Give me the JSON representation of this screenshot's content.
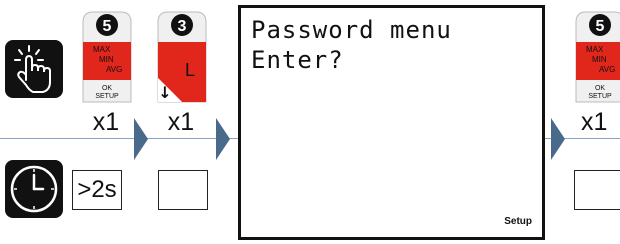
{
  "colors": {
    "accent_red": "#e1261c",
    "tile_dark": "#111111",
    "separator": "#8aa3bf",
    "chevron": "#4a6a8c"
  },
  "icons": {
    "touch": "tap-finger-icon",
    "timer": "clock-icon",
    "step_arrow": "chevron-right-icon"
  },
  "steps": [
    {
      "key": {
        "number": "5",
        "lines": [
          "MAX",
          "MIN",
          "AVG"
        ],
        "sub": [
          "OK",
          "SETUP"
        ]
      },
      "presses": "x1",
      "hold": ">2s"
    },
    {
      "key": {
        "number": "3",
        "letter": "L",
        "down_arrow": "↓"
      },
      "presses": "x1",
      "hold": ""
    },
    {
      "key": {
        "number": "5",
        "lines": [
          "MAX",
          "MIN",
          "AVG"
        ],
        "sub": [
          "OK",
          "SETUP"
        ]
      },
      "presses": "x1",
      "hold": ""
    }
  ],
  "display": {
    "line1": "Password menu",
    "line2": "Enter?",
    "corner_label": "Setup"
  }
}
